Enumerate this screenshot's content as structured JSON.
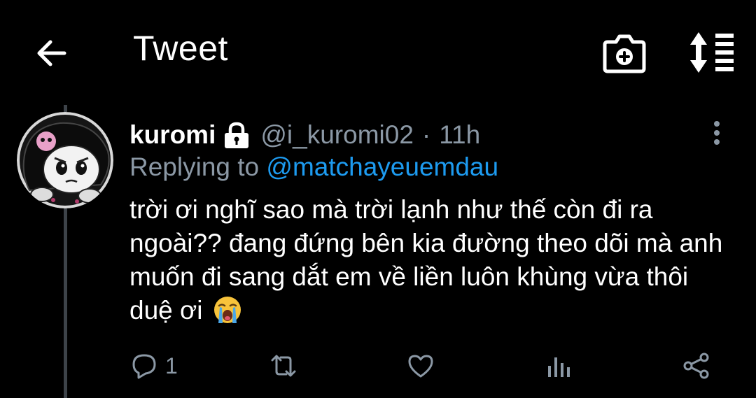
{
  "header": {
    "title": "Tweet"
  },
  "icons": {
    "back": "arrow-left-icon",
    "camera": "camera-plus-icon",
    "sort": "sort-arrows-icon",
    "lock": "lock-icon",
    "more": "more-vertical-icon",
    "reply": "reply-icon",
    "retweet": "retweet-icon",
    "like": "like-icon",
    "analytics": "analytics-icon",
    "share": "share-icon",
    "emoji": "loudly-crying-face-emoji"
  },
  "tweet": {
    "name": "kuromi",
    "handle": "@i_kuromi02",
    "separator": "·",
    "time": "11h",
    "replying_prefix": "Replying to",
    "replying_to": "@matchayeuemdau",
    "text": "trời ơi nghĩ sao mà trời lạnh như thế còn đi ra ngoài?? đang đứng bên kia đường theo dõi mà anh muốn đi sang dắt em về liền luôn khùng vừa thôi duệ ơi",
    "reply_count": "1"
  },
  "colors": {
    "background": "#000000",
    "text": "#ffffff",
    "secondary": "#8b98a5",
    "link": "#1d9bf0",
    "thread_line": "#3d4349"
  }
}
